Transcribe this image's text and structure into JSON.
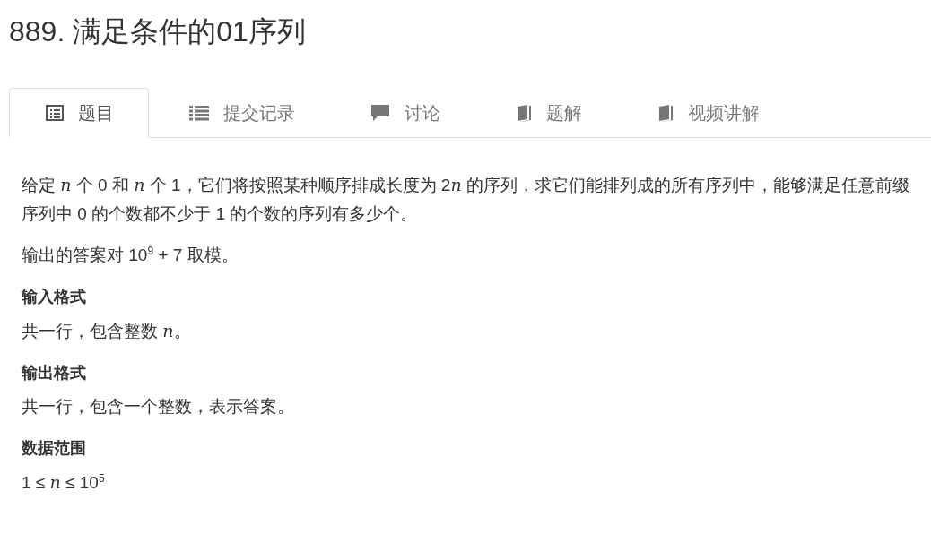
{
  "title": "889. 满足条件的01序列",
  "tabs": [
    {
      "label": "题目",
      "kind": "document",
      "selected": true
    },
    {
      "label": "提交记录",
      "kind": "list",
      "selected": false
    },
    {
      "label": "讨论",
      "kind": "comment",
      "selected": false
    },
    {
      "label": "题解",
      "kind": "book",
      "selected": false
    },
    {
      "label": "视频讲解",
      "kind": "book",
      "selected": false
    }
  ],
  "content": [
    {
      "kind": "paragraph",
      "parts": [
        {
          "kind": "text",
          "text": "给定 "
        },
        {
          "kind": "var",
          "text": "n"
        },
        {
          "kind": "text",
          "text": " 个 0 和 "
        },
        {
          "kind": "var",
          "text": "n"
        },
        {
          "kind": "text",
          "text": " 个 1，它们将按照某种顺序排成长度为 2"
        },
        {
          "kind": "var",
          "text": "n"
        },
        {
          "kind": "text",
          "text": " 的序列，求它们能排列成的所有序列中，能够满足任意前缀序列中 0 的个数都不少于 1 的个数的序列有多少个。"
        }
      ]
    },
    {
      "kind": "paragraph",
      "parts": [
        {
          "kind": "text",
          "text": "输出的答案对 10"
        },
        {
          "kind": "sup",
          "text": "9"
        },
        {
          "kind": "text",
          "text": " + 7 取模。"
        }
      ]
    },
    {
      "kind": "heading",
      "text": "输入格式"
    },
    {
      "kind": "paragraph",
      "parts": [
        {
          "kind": "text",
          "text": "共一行，包含整数 "
        },
        {
          "kind": "var",
          "text": "n"
        },
        {
          "kind": "text",
          "text": "。"
        }
      ]
    },
    {
      "kind": "heading",
      "text": "输出格式"
    },
    {
      "kind": "paragraph",
      "parts": [
        {
          "kind": "text",
          "text": "共一行，包含一个整数，表示答案。"
        }
      ]
    },
    {
      "kind": "heading",
      "text": "数据范围"
    },
    {
      "kind": "paragraph",
      "parts": [
        {
          "kind": "text",
          "text": "1 ≤ "
        },
        {
          "kind": "var",
          "text": "n"
        },
        {
          "kind": "text",
          "text": " ≤ 10"
        },
        {
          "kind": "sup",
          "text": "5"
        }
      ]
    }
  ]
}
